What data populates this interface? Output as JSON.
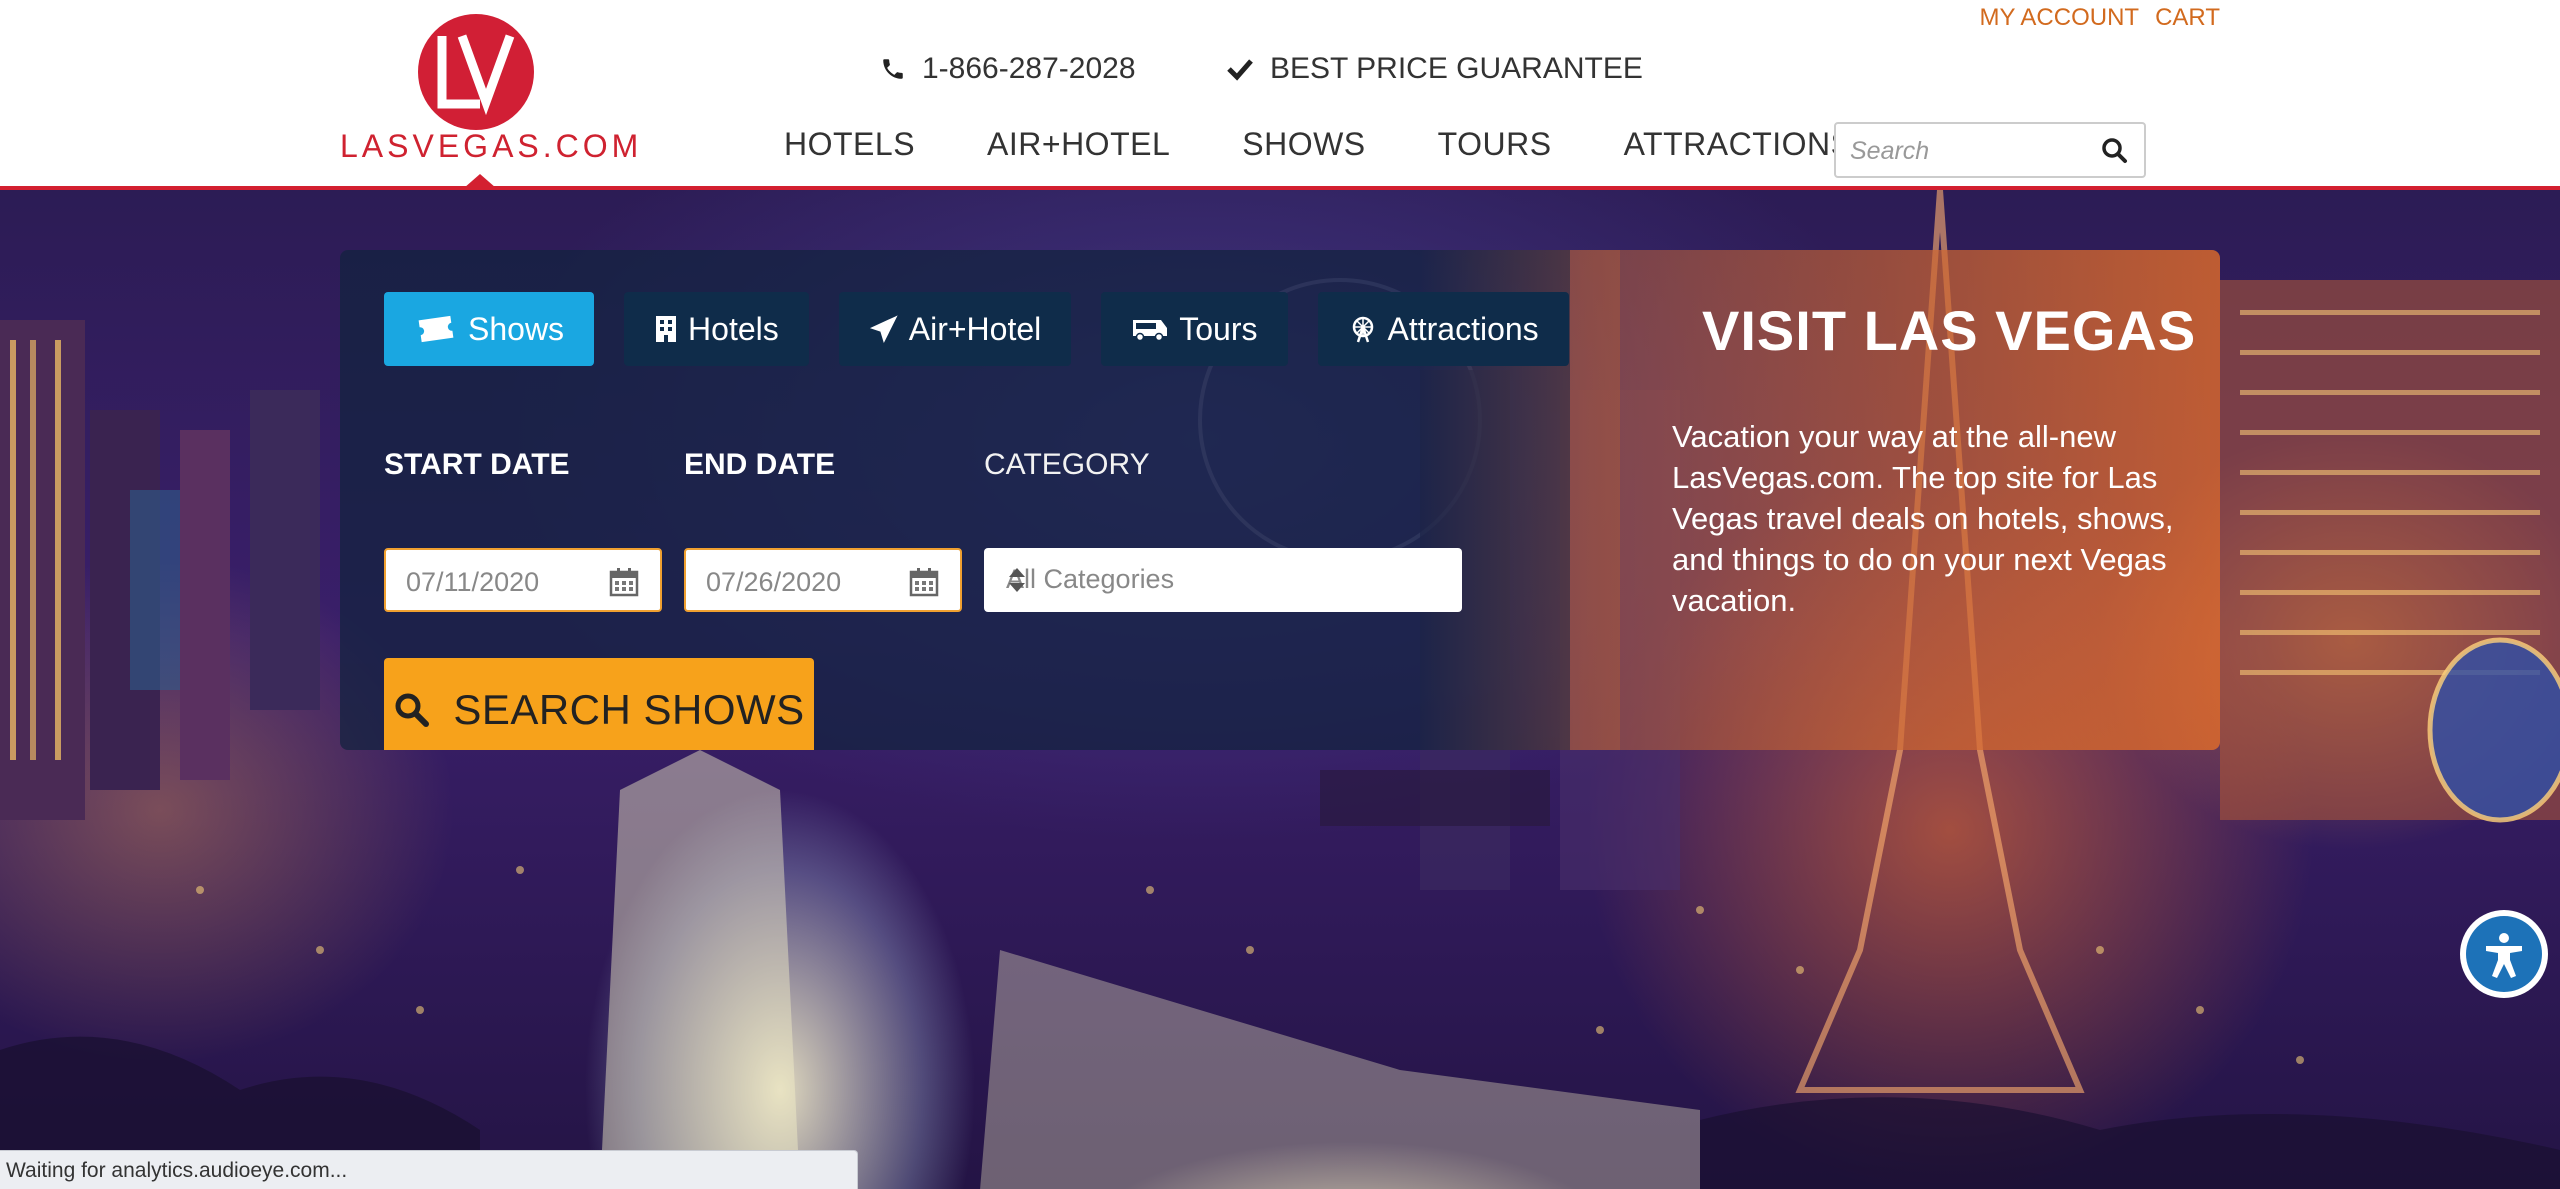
{
  "header": {
    "logo_text": "LASVEGAS.COM",
    "logo_mark": "LV",
    "phone": "1-866-287-2028",
    "guarantee": "BEST PRICE GUARANTEE",
    "account_links": {
      "my_account": "MY ACCOUNT",
      "cart": "CART"
    },
    "nav": [
      "HOTELS",
      "AIR+HOTEL",
      "SHOWS",
      "TOURS",
      "ATTRACTIONS"
    ],
    "search": {
      "placeholder": "Search",
      "value": ""
    },
    "brand_color": "#d32030"
  },
  "search_panel": {
    "tabs": [
      {
        "label": "Shows",
        "icon": "ticket-icon",
        "active": true
      },
      {
        "label": "Hotels",
        "icon": "building-icon",
        "active": false
      },
      {
        "label": "Air+Hotel",
        "icon": "plane-icon",
        "active": false
      },
      {
        "label": "Tours",
        "icon": "bus-icon",
        "active": false
      },
      {
        "label": "Attractions",
        "icon": "ferris-wheel-icon",
        "active": false
      }
    ],
    "start_date": {
      "label": "START DATE",
      "value": "07/11/2020"
    },
    "end_date": {
      "label": "END DATE",
      "value": "07/26/2020"
    },
    "category": {
      "label": "CATEGORY",
      "value": "All Categories"
    },
    "submit_label": "SEARCH SHOWS",
    "accent_color": "#f7a21b",
    "active_tab_color": "#1aa7e1"
  },
  "promo": {
    "title": "VISIT LAS VEGAS",
    "body": "Vacation your way at the all-new LasVegas.com. The top site for Las Vegas travel deals on hotels, shows, and things to do on your next Vegas vacation."
  },
  "status_bar": {
    "text": "Waiting for analytics.audioeye.com..."
  }
}
